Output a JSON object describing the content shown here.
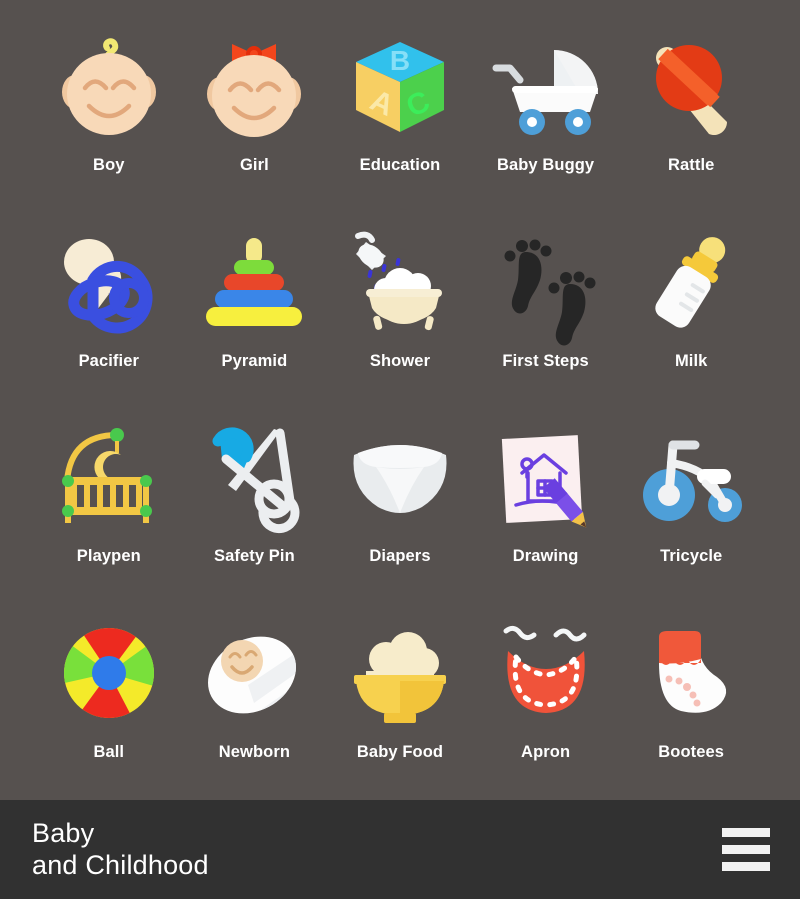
{
  "theme": {
    "background": "#56514f",
    "footer_background": "#313131",
    "label_color": "#ffffff",
    "title_color": "#ffffff"
  },
  "footer": {
    "title_line1": "Baby",
    "title_line2": "and Childhood",
    "menu_icon": "hamburger-menu-icon"
  },
  "grid": {
    "columns": 5,
    "rows": 4,
    "items": [
      {
        "label": "Boy",
        "icon": "baby-boy-face-icon",
        "colors": [
          "#f8d9b8",
          "#f2e873"
        ]
      },
      {
        "label": "Girl",
        "icon": "baby-girl-face-icon",
        "colors": [
          "#f8d9b8",
          "#f3461c"
        ]
      },
      {
        "label": "Education",
        "icon": "alphabet-blocks-icon",
        "colors": [
          "#31c1ec",
          "#f7cf63",
          "#4cd04c"
        ]
      },
      {
        "label": "Baby Buggy",
        "icon": "baby-stroller-icon",
        "colors": [
          "#fbfbfb",
          "#4e9fd8"
        ]
      },
      {
        "label": "Rattle",
        "icon": "rattle-toy-icon",
        "colors": [
          "#e33b15",
          "#f4e3b9"
        ]
      },
      {
        "label": "Pacifier",
        "icon": "pacifier-icon",
        "colors": [
          "#f7ecd5",
          "#3a4fe0"
        ]
      },
      {
        "label": "Pyramid",
        "icon": "stacking-rings-icon",
        "colors": [
          "#f7ef3e",
          "#3a86e8",
          "#e8472a",
          "#7ddc3b"
        ]
      },
      {
        "label": "Shower",
        "icon": "bath-shower-icon",
        "colors": [
          "#f5e9c6",
          "#ffffff",
          "#3a34d8"
        ]
      },
      {
        "label": "First Steps",
        "icon": "footprints-icon",
        "colors": [
          "#262626"
        ]
      },
      {
        "label": "Milk",
        "icon": "baby-bottle-icon",
        "colors": [
          "#fbfbfb",
          "#f5c93a"
        ]
      },
      {
        "label": "Playpen",
        "icon": "crib-playpen-icon",
        "colors": [
          "#f2c744",
          "#49c94d"
        ]
      },
      {
        "label": "Safety Pin",
        "icon": "safety-pin-icon",
        "colors": [
          "#eceef0",
          "#17aae4"
        ]
      },
      {
        "label": "Diapers",
        "icon": "diaper-icon",
        "colors": [
          "#f4f5f6",
          "#d9dcdd"
        ]
      },
      {
        "label": "Drawing",
        "icon": "child-drawing-icon",
        "colors": [
          "#fbeff0",
          "#6a3fe0",
          "#f2c14a"
        ]
      },
      {
        "label": "Tricycle",
        "icon": "tricycle-icon",
        "colors": [
          "#f1f2f3",
          "#4e9fd8"
        ]
      },
      {
        "label": "Ball",
        "icon": "beach-ball-icon",
        "colors": [
          "#ed2a1f",
          "#f4ea2a",
          "#79e03b",
          "#2f7bea"
        ]
      },
      {
        "label": "Newborn",
        "icon": "swaddled-newborn-icon",
        "colors": [
          "#fdfdfd",
          "#f3d6b2"
        ]
      },
      {
        "label": "Baby Food",
        "icon": "food-bowl-icon",
        "colors": [
          "#f7d14e",
          "#f7eccb"
        ]
      },
      {
        "label": "Apron",
        "icon": "bib-apron-icon",
        "colors": [
          "#f0533a",
          "#ffffff"
        ]
      },
      {
        "label": "Bootees",
        "icon": "baby-bootie-icon",
        "colors": [
          "#fdfdfd",
          "#f0583a",
          "#f6bfb6"
        ]
      }
    ]
  }
}
